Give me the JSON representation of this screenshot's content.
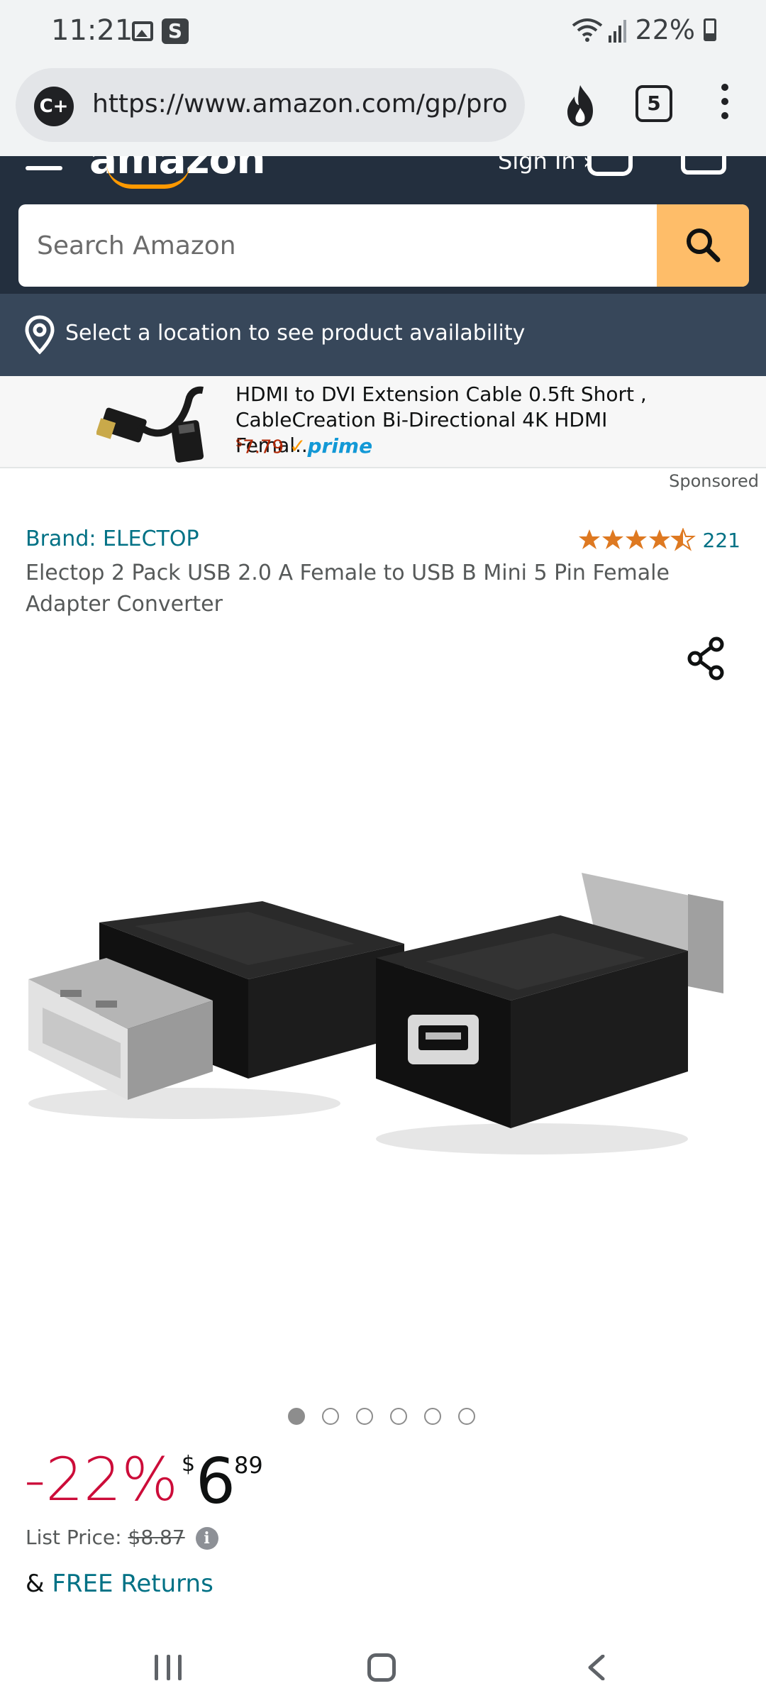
{
  "status_bar": {
    "time": "11:21",
    "battery": "22%",
    "icons": [
      "image-icon",
      "s-app-icon",
      "wifi-icon",
      "signal-icon",
      "battery-icon"
    ]
  },
  "browser": {
    "url": "https://www.amazon.com/gp/product/",
    "tab_count": "5",
    "cplus_label": "C+"
  },
  "amazon_header": {
    "logo": "amazon",
    "signin": "Sign In ›",
    "search_placeholder": "Search Amazon"
  },
  "location": {
    "text": "Select a location to see product availability"
  },
  "sponsored_ad": {
    "title": "HDMI to DVI Extension Cable 0.5ft Short , CableCreation Bi-Directional 4K HDMI Femal...",
    "price_symbol": "$",
    "price_value": "7.79",
    "prime": "prime",
    "label": "Sponsored"
  },
  "product": {
    "brand": "Brand: ELECTOP",
    "rating_stars": 4.5,
    "rating_count": "221",
    "title": "Electop 2 Pack USB 2.0 A Female to USB B Mini 5 Pin Female Adapter Converter",
    "image_count": 6,
    "active_image": 1
  },
  "pricing": {
    "discount": "-22%",
    "currency": "$",
    "whole": "6",
    "fraction": "89",
    "list_price_label": "List Price:",
    "list_price_value": "$8.87",
    "returns_prefix": "&",
    "returns_link": "FREE Returns"
  },
  "colors": {
    "header_bg": "#232f3e",
    "location_bg": "#37475a",
    "search_button": "#febd69",
    "link": "#007185",
    "discount": "#cc0c39",
    "star": "#de7921"
  }
}
